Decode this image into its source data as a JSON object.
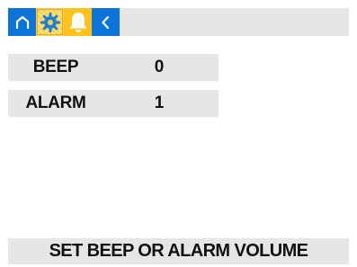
{
  "toolbar": {
    "buttons": [
      {
        "icon": "home-icon",
        "color": "#0a74d8"
      },
      {
        "icon": "gear-icon",
        "color": "#ffd24a"
      },
      {
        "icon": "bell-icon",
        "color": "#ffc21c"
      },
      {
        "icon": "back-icon",
        "color": "#0a74d8"
      }
    ]
  },
  "settings": [
    {
      "label": "BEEP",
      "value": "0"
    },
    {
      "label": "ALARM",
      "value": "1"
    }
  ],
  "status": {
    "text": "SET BEEP OR ALARM VOLUME"
  },
  "colors": {
    "accent_blue": "#0a74d8",
    "accent_yellow": "#ffc21c",
    "panel_gray": "#e6e6e6"
  }
}
